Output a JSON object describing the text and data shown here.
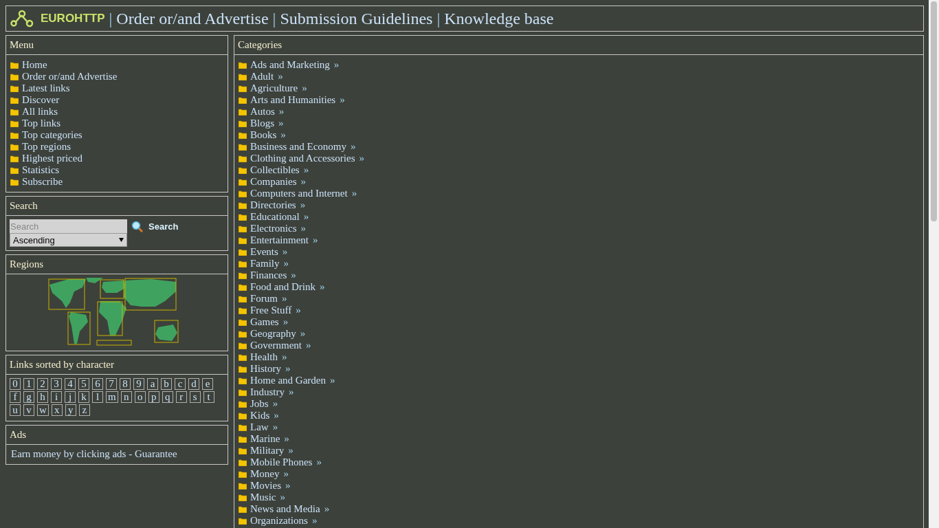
{
  "header": {
    "brand": "EUROHTTP",
    "separator": "|",
    "links": [
      "Order or/and Advertise",
      "Submission Guidelines",
      "Knowledge base"
    ]
  },
  "menu": {
    "title": "Menu",
    "items": [
      "Home",
      "Order or/and Advertise",
      "Latest links",
      "Discover",
      "All links",
      "Top links",
      "Top categories",
      "Top regions",
      "Highest priced",
      "Statistics",
      "Subscribe"
    ]
  },
  "search": {
    "title": "Search",
    "placeholder": "Search",
    "sort": "Ascending",
    "button": "Search"
  },
  "regions": {
    "title": "Regions"
  },
  "characters": {
    "title": "Links sorted by character",
    "items": [
      "0",
      "1",
      "2",
      "3",
      "4",
      "5",
      "6",
      "7",
      "8",
      "9",
      "a",
      "b",
      "c",
      "d",
      "e",
      "f",
      "g",
      "h",
      "i",
      "j",
      "k",
      "l",
      "m",
      "n",
      "o",
      "p",
      "q",
      "r",
      "s",
      "t",
      "u",
      "v",
      "w",
      "x",
      "y",
      "z"
    ]
  },
  "ads": {
    "title": "Ads",
    "items": [
      "Earn money by clicking ads - Guarantee"
    ]
  },
  "categories": {
    "title": "Categories",
    "more": "»",
    "items": [
      "Ads and Marketing",
      "Adult",
      "Agriculture",
      "Arts and Humanities",
      "Autos",
      "Blogs",
      "Books",
      "Business and Economy",
      "Clothing and Accessories",
      "Collectibles",
      "Companies",
      "Computers and Internet",
      "Directories",
      "Educational",
      "Electronics",
      "Entertainment",
      "Events",
      "Family",
      "Finances",
      "Food and Drink",
      "Forum",
      "Free Stuff",
      "Games",
      "Geography",
      "Government",
      "Health",
      "History",
      "Home and Garden",
      "Industry",
      "Jobs",
      "Kids",
      "Law",
      "Marine",
      "Military",
      "Mobile Phones",
      "Money",
      "Movies",
      "Music",
      "News and Media",
      "Organizations"
    ]
  }
}
